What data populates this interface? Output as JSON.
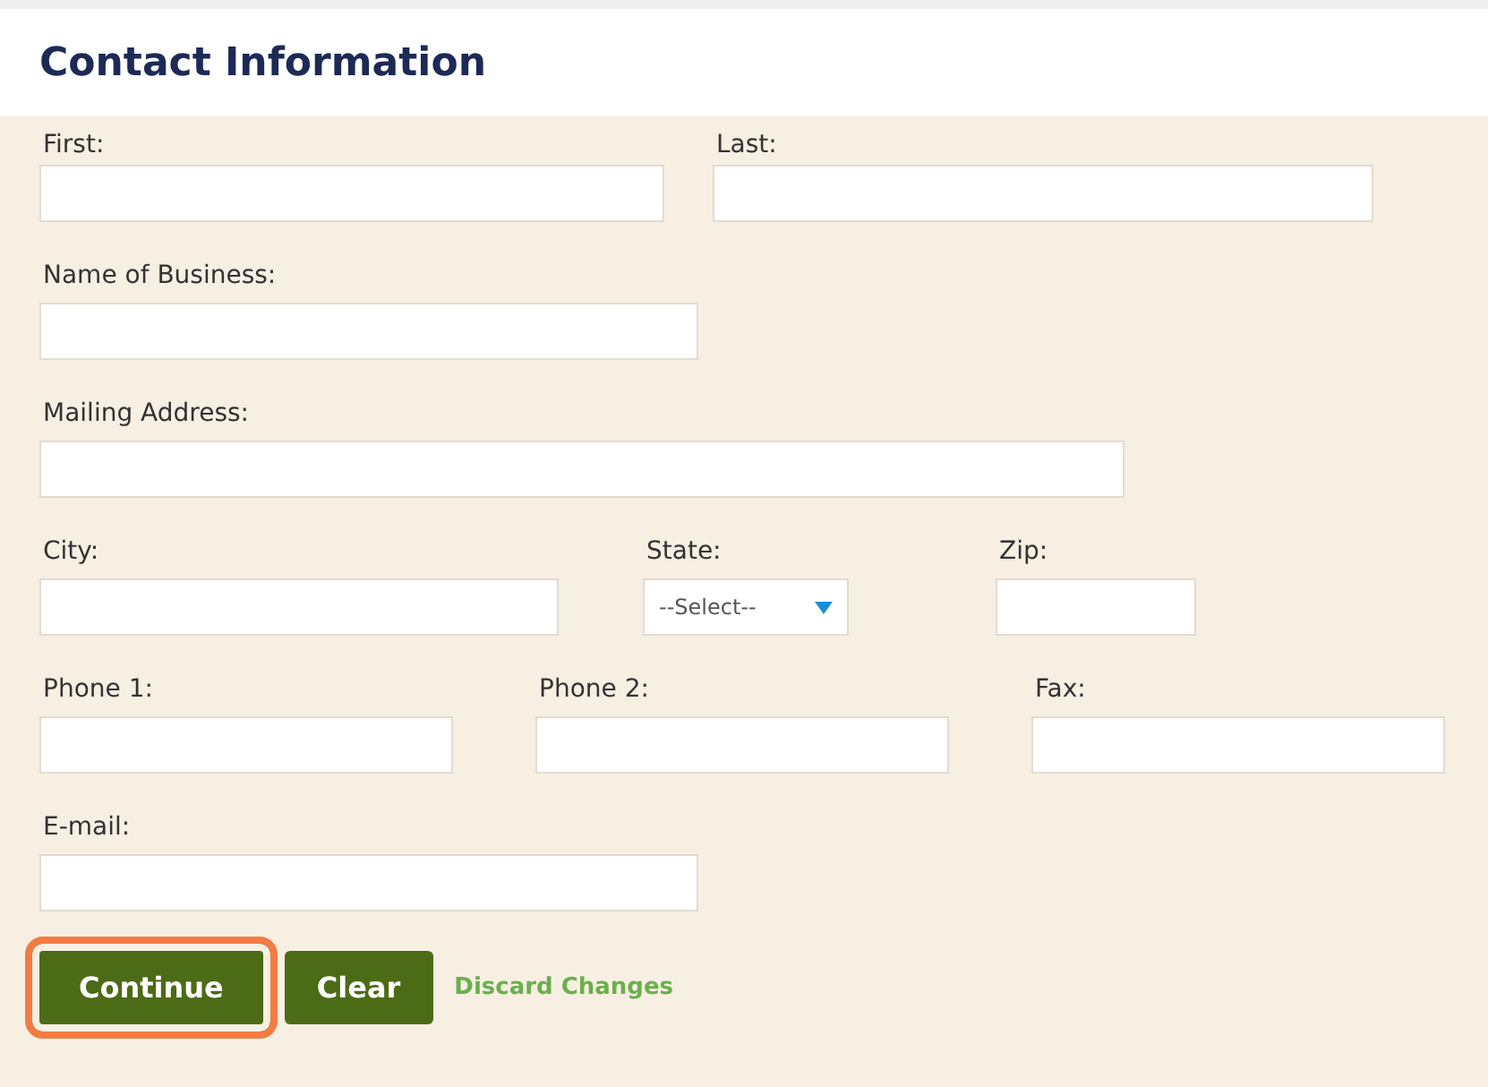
{
  "title": "Contact Information",
  "rows": [
    {
      "fields": [
        {
          "label": "First:",
          "kind": "text"
        },
        {
          "label": "Last:",
          "kind": "text"
        }
      ]
    },
    {
      "fields": [
        {
          "label": "Name of Business:",
          "kind": "text"
        }
      ]
    },
    {
      "fields": [
        {
          "label": "Mailing Address:",
          "kind": "text"
        }
      ]
    },
    {
      "fields": [
        {
          "label": "City:",
          "kind": "text"
        },
        {
          "label": "State:",
          "kind": "select",
          "value": "--Select--"
        },
        {
          "label": "Zip:",
          "kind": "text"
        }
      ]
    },
    {
      "fields": [
        {
          "label": "Phone 1:",
          "kind": "text"
        },
        {
          "label": "Phone 2:",
          "kind": "text"
        },
        {
          "label": "Fax:",
          "kind": "text"
        }
      ]
    },
    {
      "fields": [
        {
          "label": "E-mail:",
          "kind": "text"
        }
      ]
    }
  ],
  "buttons": [
    {
      "label": "Continue",
      "kind": "button",
      "highlighted": true
    },
    {
      "label": "Clear",
      "kind": "button",
      "highlighted": false
    },
    {
      "label": "Discard Changes",
      "kind": "link",
      "highlighted": false
    }
  ]
}
